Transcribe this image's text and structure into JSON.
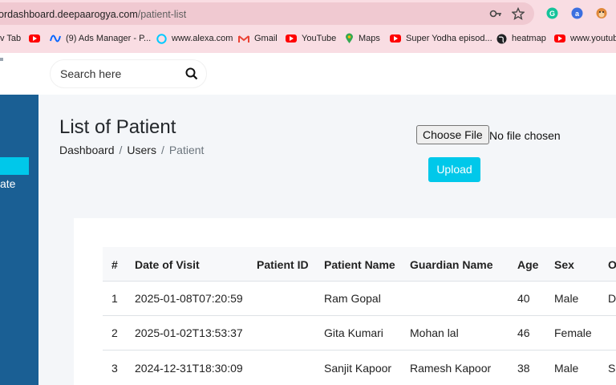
{
  "browser": {
    "url_host": "ordashboard.deepaarogya.com",
    "url_path": "/patient-list",
    "bookmarks": [
      {
        "label": "v Tab",
        "icon": "new-tab-icon"
      },
      {
        "label": "",
        "icon": "youtube-icon"
      },
      {
        "label": "(9) Ads Manager - P...",
        "icon": "meta-icon"
      },
      {
        "label": "www.alexa.com",
        "icon": "alexa-icon"
      },
      {
        "label": "Gmail",
        "icon": "gmail-icon"
      },
      {
        "label": "YouTube",
        "icon": "youtube-icon"
      },
      {
        "label": "Maps",
        "icon": "maps-icon"
      },
      {
        "label": "Super Yodha episod...",
        "icon": "youtube-icon"
      },
      {
        "label": "heatmap",
        "icon": "globe-icon"
      },
      {
        "label": "www.youtub",
        "icon": "youtube-icon"
      }
    ]
  },
  "search": {
    "placeholder": "Search here"
  },
  "sidebar": {
    "partial_label": "ate"
  },
  "page": {
    "title": "List of Patient",
    "breadcrumb": [
      "Dashboard",
      "Users",
      "Patient"
    ]
  },
  "upload": {
    "choose_label": "Choose File",
    "status": "No file chosen",
    "button_label": "Upload"
  },
  "table": {
    "headers": [
      "#",
      "Date of Visit",
      "Patient ID",
      "Patient Name",
      "Guardian Name",
      "Age",
      "Sex",
      "O"
    ],
    "rows": [
      [
        "1",
        "2025-01-08T07:20:59",
        "",
        "Ram Gopal",
        "",
        "40",
        "Male",
        "D"
      ],
      [
        "2",
        "2025-01-02T13:53:37",
        "",
        "Gita Kumari",
        "Mohan lal",
        "46",
        "Female",
        ""
      ],
      [
        "3",
        "2024-12-31T18:30:09",
        "",
        "Sanjit Kapoor",
        "Ramesh Kapoor",
        "38",
        "Male",
        "Sa"
      ]
    ]
  }
}
